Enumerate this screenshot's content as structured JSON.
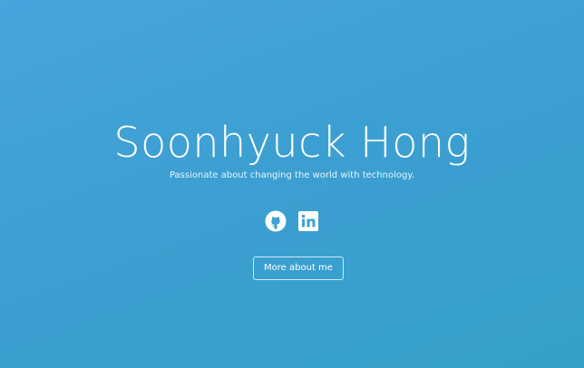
{
  "hero": {
    "name": "Soonhyuck Hong",
    "tagline": "Passionate about changing the world with technology.",
    "more_button_label": "More about me"
  },
  "socials": [
    {
      "icon": "github-icon"
    },
    {
      "icon": "linkedin-icon"
    }
  ],
  "colors": {
    "background_start": "#47a5dc",
    "background_end": "#34a0c9",
    "text": "#ffffff"
  }
}
